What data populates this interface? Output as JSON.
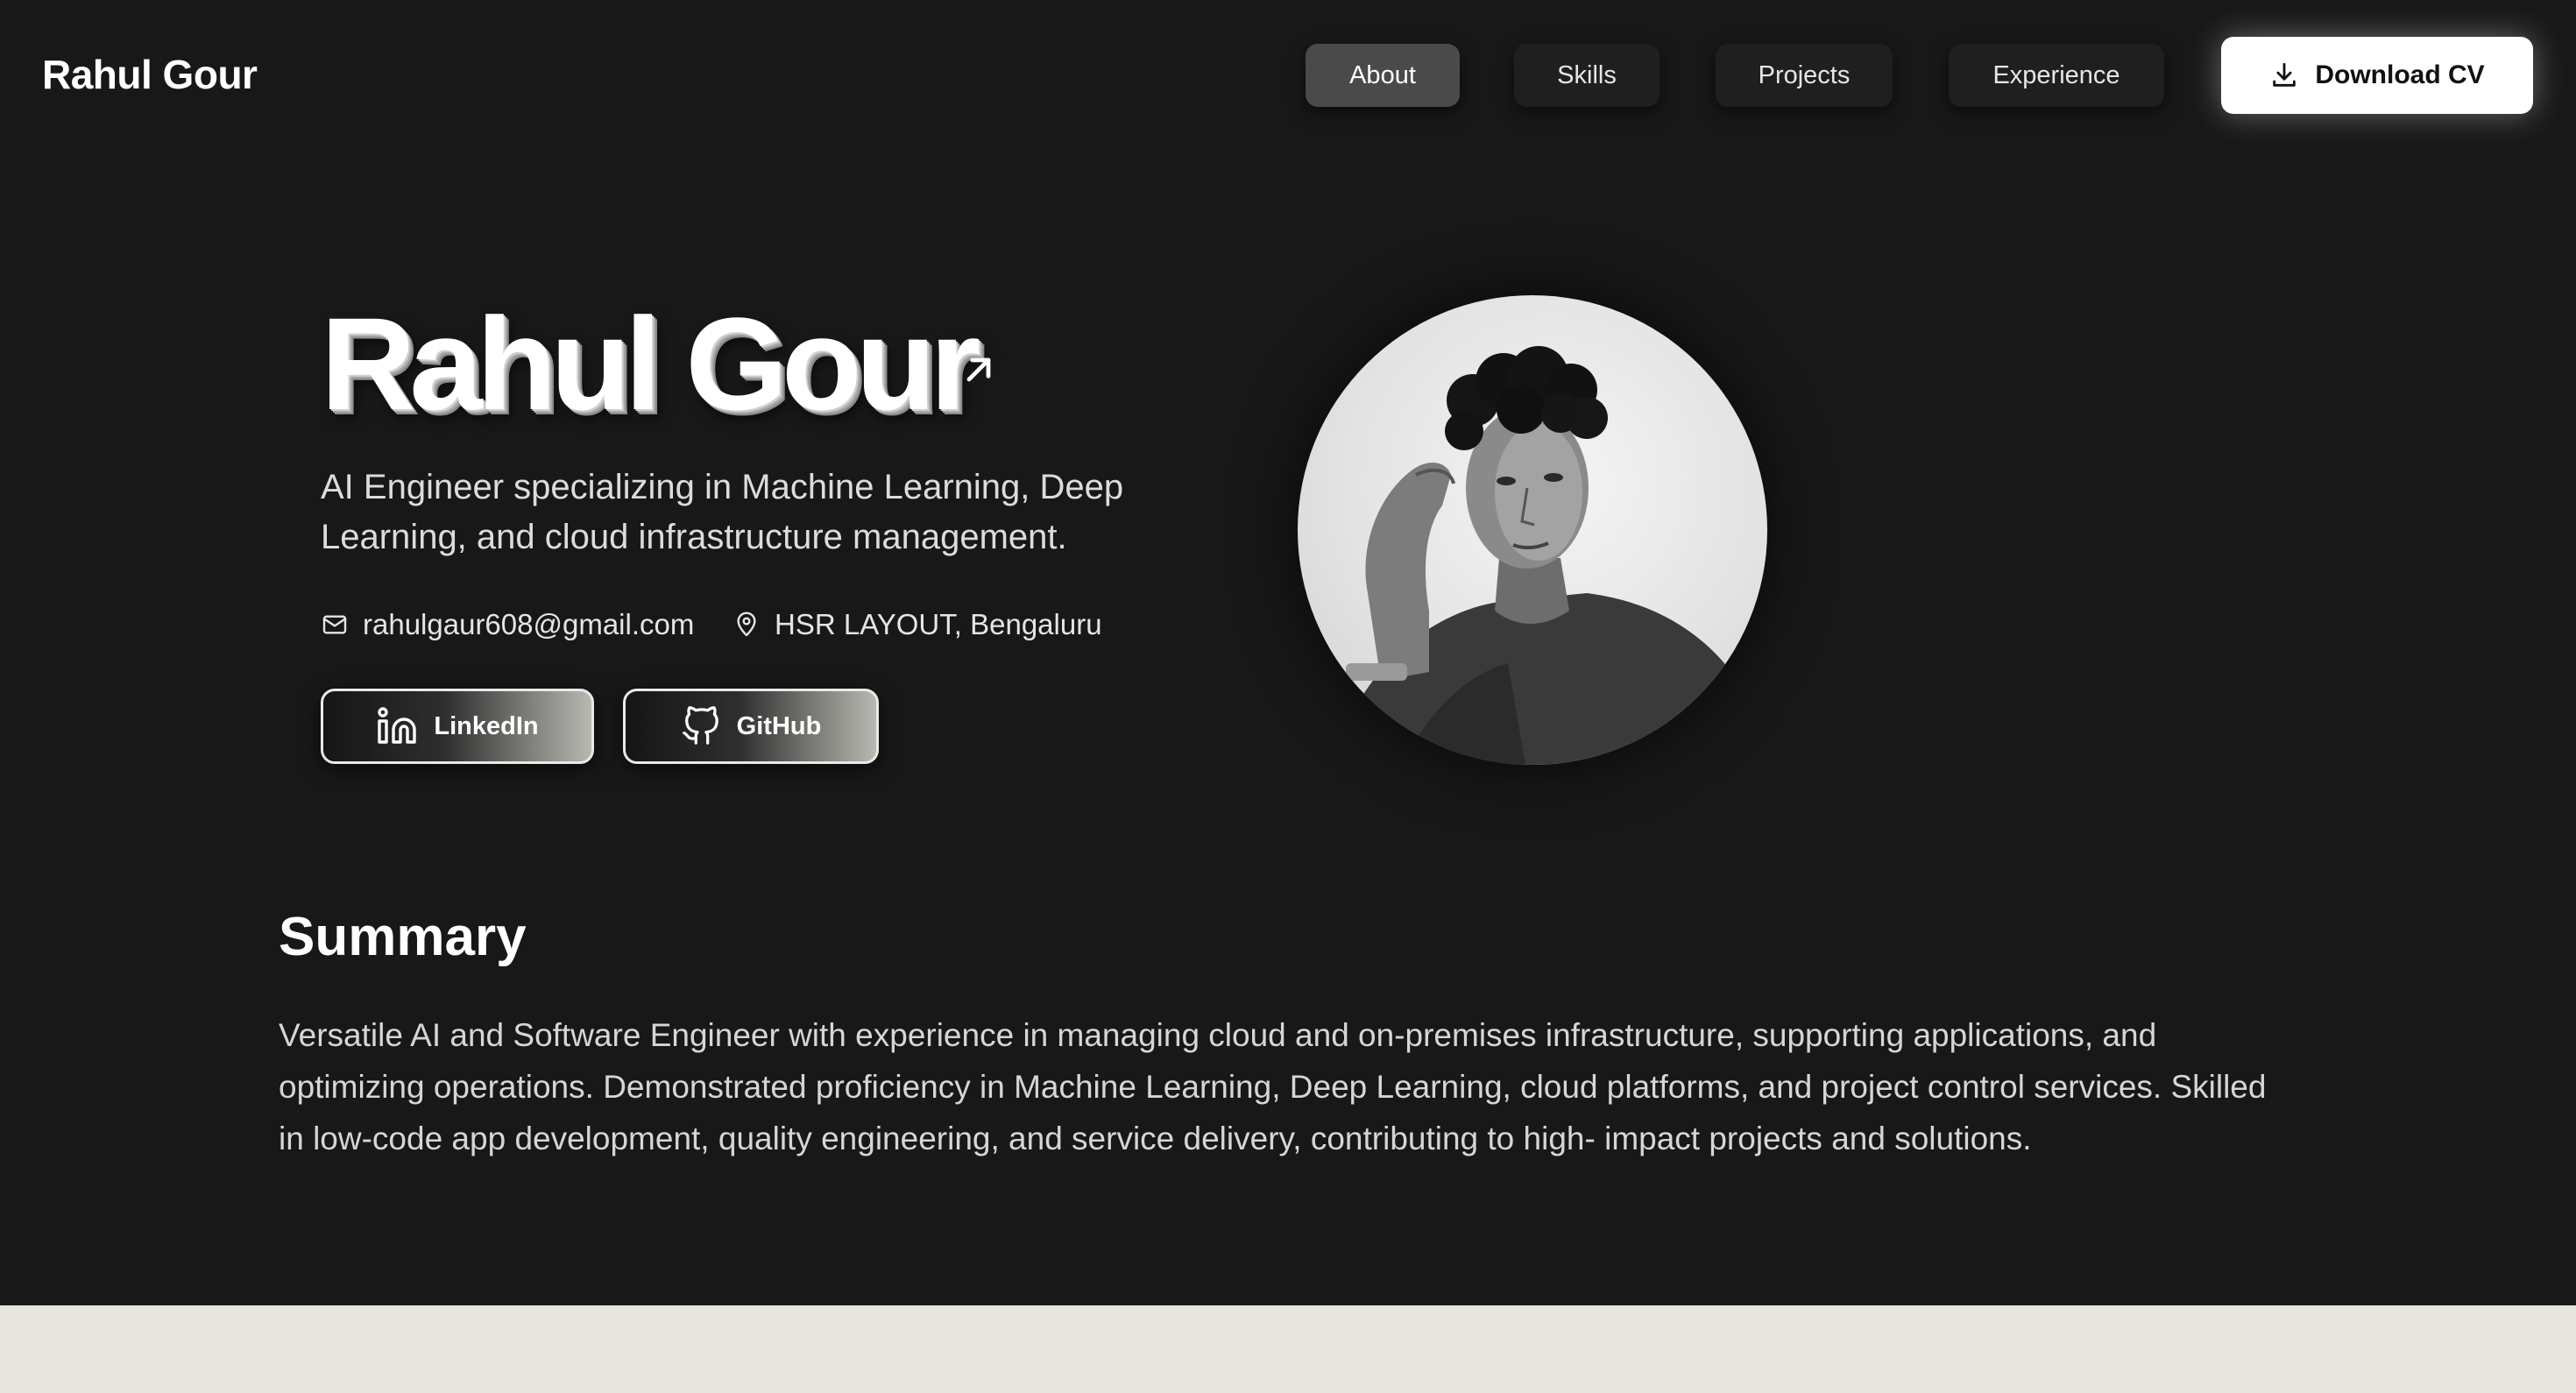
{
  "header": {
    "brand": "Rahul Gour",
    "nav": [
      {
        "label": "About",
        "active": true
      },
      {
        "label": "Skills",
        "active": false
      },
      {
        "label": "Projects",
        "active": false
      },
      {
        "label": "Experience",
        "active": false
      }
    ],
    "download_cv": {
      "label": "Download CV",
      "icon": "download-icon"
    }
  },
  "hero": {
    "name": "Rahul Gour",
    "name_icon": "arrow-up-right-icon",
    "tagline": "AI Engineer specializing in Machine Learning, Deep Learning, and cloud infrastructure management.",
    "email": {
      "icon": "mail-icon",
      "text": "rahulgaur608@gmail.com"
    },
    "location": {
      "icon": "map-pin-icon",
      "text": "HSR LAYOUT, Bengaluru"
    },
    "social": [
      {
        "label": "LinkedIn",
        "icon": "linkedin-icon"
      },
      {
        "label": "GitHub",
        "icon": "github-icon"
      }
    ],
    "photo": "profile-photo"
  },
  "summary": {
    "title": "Summary",
    "text": "Versatile AI and Software Engineer with experience in managing cloud and on-premises infrastructure, supporting applications, and optimizing operations. Demonstrated proficiency in Machine Learning, Deep Learning, cloud platforms, and project control services. Skilled in low-code app development, quality engineering, and service delivery, contributing to high- impact projects and solutions."
  },
  "colors": {
    "background": "#181818",
    "footer_band": "#e8e5df",
    "nav_active": "#4a4a4a",
    "cv_button": "#ffffff"
  }
}
